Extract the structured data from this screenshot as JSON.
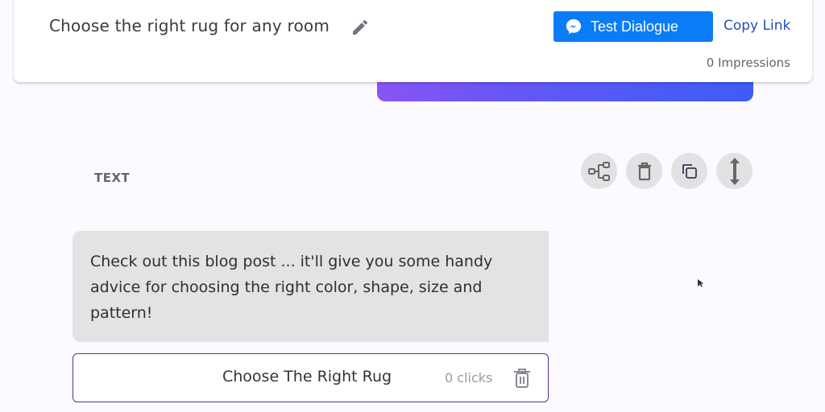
{
  "header": {
    "title": "Choose the right rug for any room",
    "test_button_label": "Test Dialogue",
    "copy_link_label": "Copy Link",
    "impressions": "0 Impressions"
  },
  "section": {
    "label": "TEXT",
    "actions": [
      {
        "name": "flow",
        "icon": "flow-diagram-icon"
      },
      {
        "name": "delete",
        "icon": "trash-icon"
      },
      {
        "name": "duplicate",
        "icon": "copy-icon"
      },
      {
        "name": "move",
        "icon": "vertical-arrows-icon"
      }
    ]
  },
  "message": {
    "text": "Check out this blog post ... it'll give you some handy advice for choosing the right color, shape, size and pattern!"
  },
  "link_button": {
    "label": "Choose The Right Rug",
    "clicks": "0 clicks"
  },
  "colors": {
    "primary_button": "#0a7cf7",
    "link_text": "#2b4bb8",
    "button_border": "#5a2b9e",
    "gradient_start": "#8a55f5",
    "gradient_end": "#3d5cf9"
  }
}
